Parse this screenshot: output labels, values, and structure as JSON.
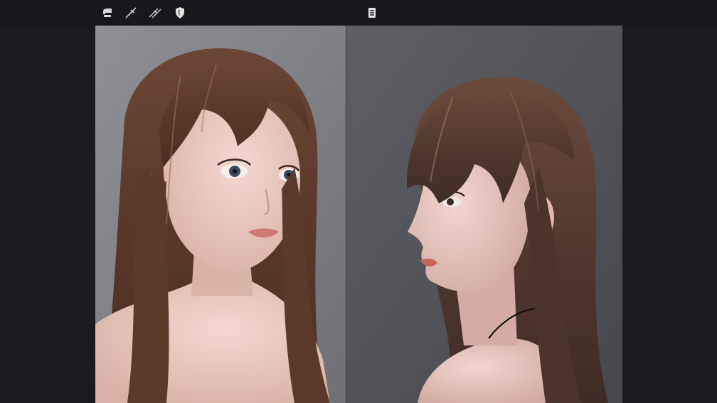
{
  "toolbar": {
    "tools": [
      {
        "icon": "brush-icon"
      },
      {
        "icon": "line-tool-icon"
      },
      {
        "icon": "double-line-tool-icon"
      },
      {
        "icon": "shield-icon"
      }
    ],
    "center_tool": {
      "icon": "layers-icon"
    }
  },
  "canvas": {
    "panels": [
      {
        "subject": "portrait-front-three-quarter"
      },
      {
        "subject": "portrait-profile"
      }
    ]
  },
  "colors": {
    "toolbar_bg": "#17181b",
    "workspace_bg": "#1a1b1e",
    "icon": "#d8d8d8",
    "left_backdrop": "#8a8c92",
    "right_backdrop": "#55575d",
    "hair": "#5a3a2c",
    "skin": "#e9c9c0"
  }
}
